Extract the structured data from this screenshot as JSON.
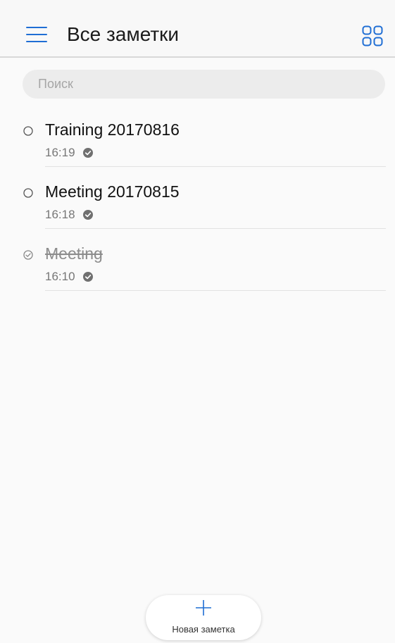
{
  "header": {
    "title": "Все заметки",
    "menu_icon": "hamburger-menu-icon",
    "view_icon": "grid-view-icon",
    "accent_color": "#1f6ed4"
  },
  "search": {
    "placeholder": "Поиск",
    "value": ""
  },
  "notes": [
    {
      "title": "Training 20170816",
      "time": "16:19",
      "completed": false,
      "synced": true
    },
    {
      "title": "Meeting 20170815",
      "time": "16:18",
      "completed": false,
      "synced": true
    },
    {
      "title": "Meeting",
      "time": "16:10",
      "completed": true,
      "synced": true
    }
  ],
  "new_note": {
    "label": "Новая заметка",
    "icon": "plus-icon"
  }
}
